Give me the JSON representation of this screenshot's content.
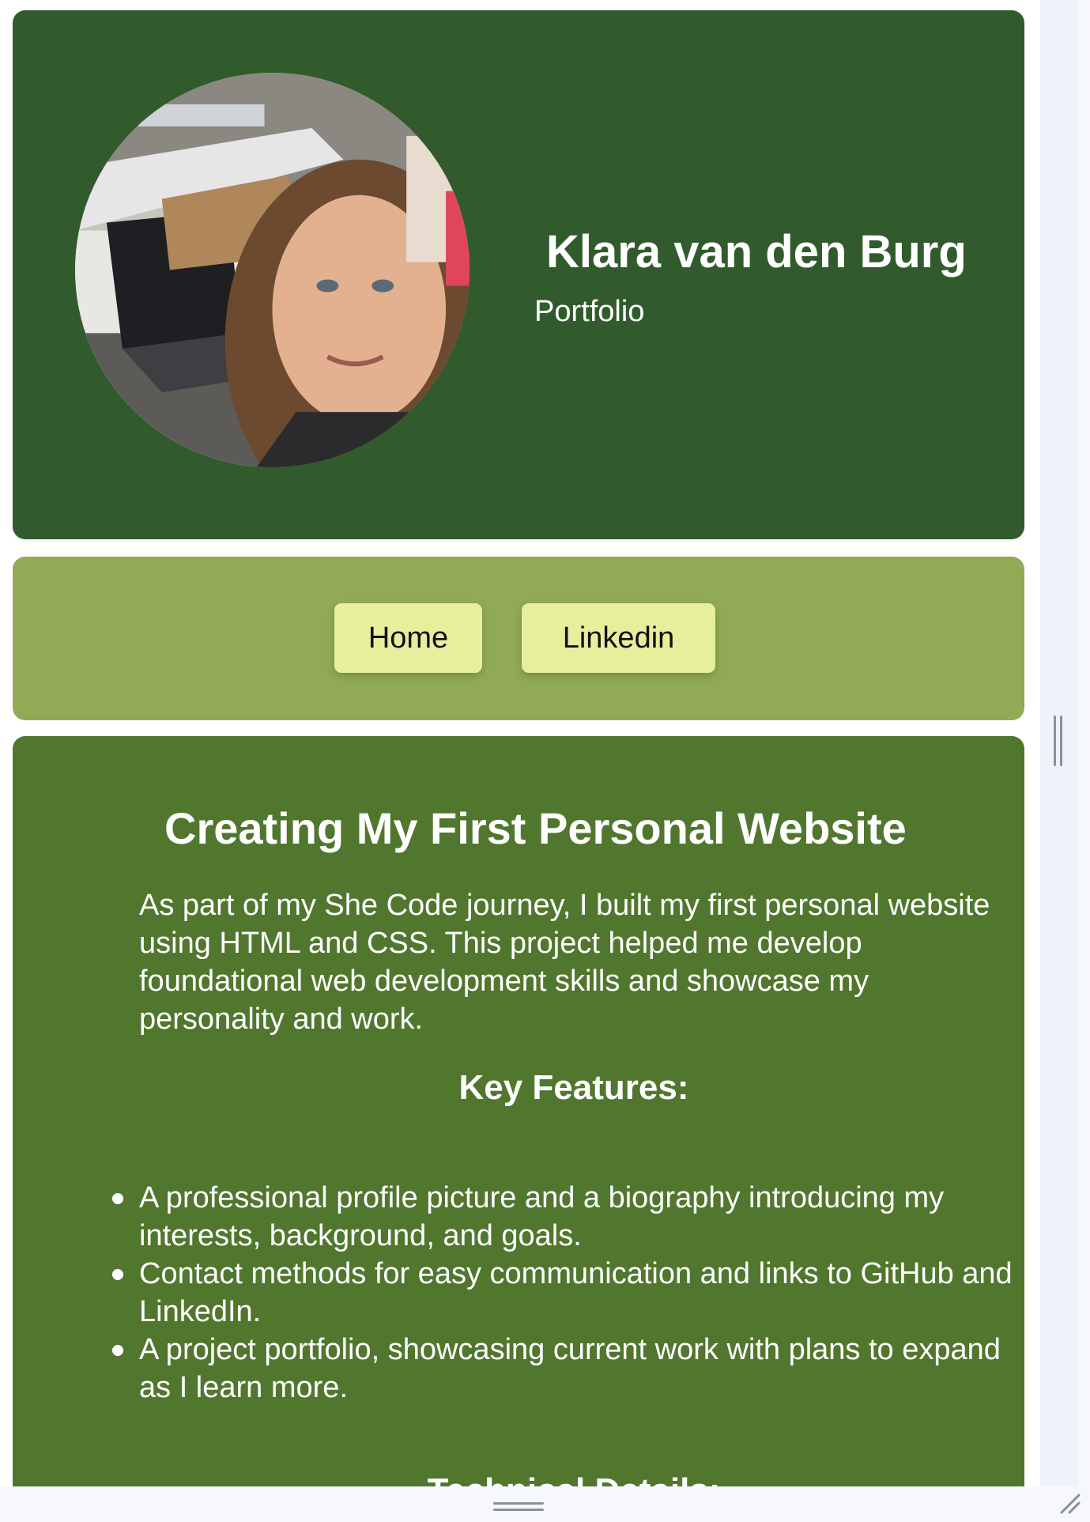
{
  "header": {
    "name": "Klara van den Burg",
    "subtitle": "Portfolio",
    "background_color": "#325b2d"
  },
  "nav": {
    "background_color": "#92aa55",
    "button_color": "#e7ef9d",
    "buttons": [
      {
        "label": "Home"
      },
      {
        "label": "Linkedin"
      }
    ]
  },
  "content": {
    "background_color": "#51772f",
    "title": "Creating My First Personal Website",
    "intro": "As part of my She Code journey, I built my first personal website using HTML and CSS. This project helped me develop foundational web development skills and showcase my personality and work.",
    "features_heading": "Key Features:",
    "features": [
      "A professional profile picture and a biography introducing my interests, background, and goals.",
      "Contact methods for easy communication and links to GitHub and LinkedIn.",
      "A project portfolio, showcasing current work with plans to expand as I learn more."
    ],
    "technical_heading": "Technical Details:"
  },
  "icons": {
    "avatar": "profile-photo",
    "bottom_handle": "drag-handle-icon",
    "side_handle": "drag-handle-icon",
    "resize": "resize-corner-icon"
  }
}
